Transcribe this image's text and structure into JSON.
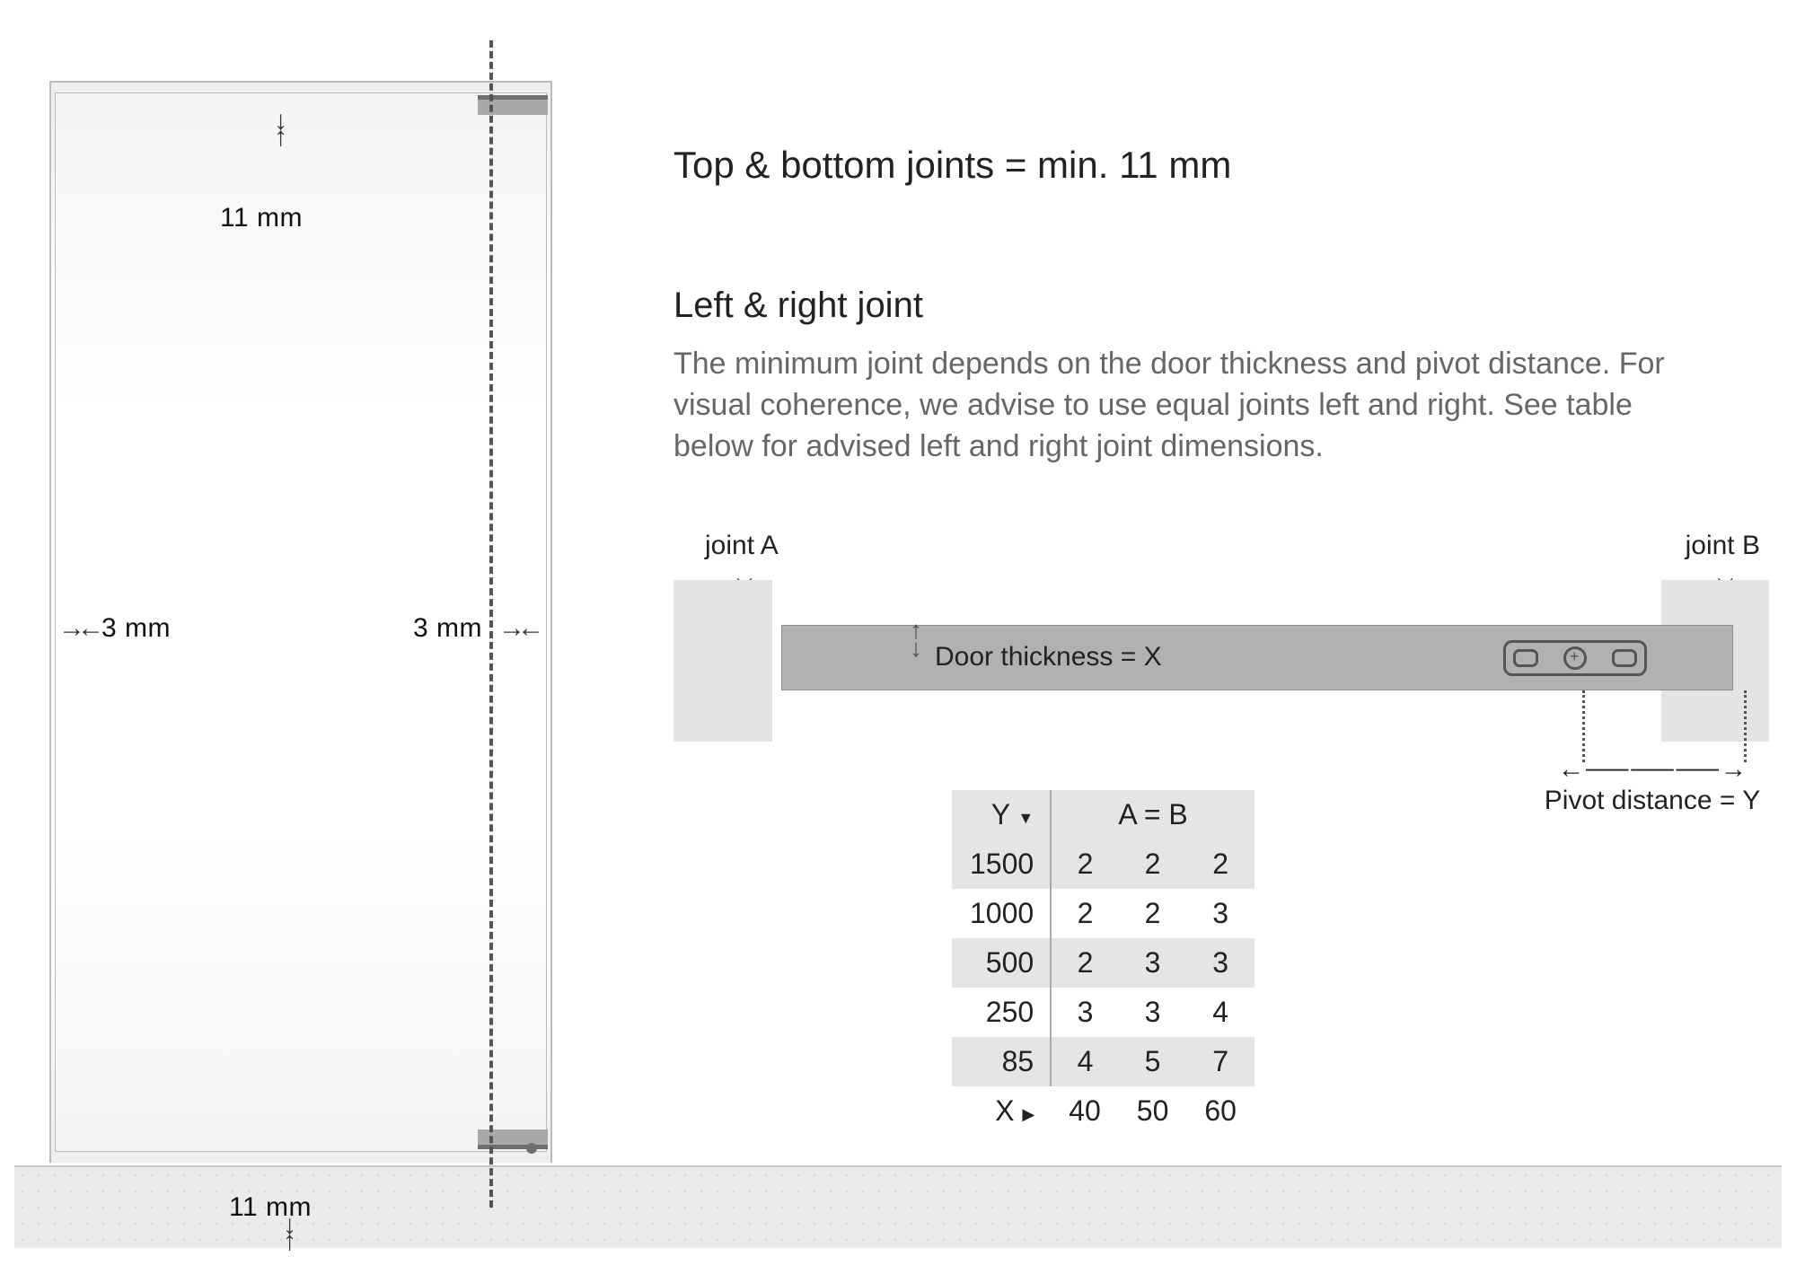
{
  "elevation": {
    "top_joint": "11 mm",
    "bottom_joint": "11 mm",
    "left_joint": "3 mm",
    "right_joint": "3 mm"
  },
  "headline": "Top & bottom joints  = min. 11 mm",
  "section_title": "Left & right joint",
  "section_body": "The minimum joint depends on the door thickness and pivot distance. For visual coherence, we advise to use equal joints left and right. See table below for advised left and right joint dimensions.",
  "topview": {
    "joint_a_label": "joint A",
    "joint_b_label": "joint B",
    "thickness_label": "Door thickness = X",
    "pivot_label": "Pivot distance = Y"
  },
  "table": {
    "y_header": "Y",
    "ab_header": "A = B",
    "x_header": "X",
    "rows": [
      {
        "y": "1500",
        "v": [
          "2",
          "2",
          "2"
        ]
      },
      {
        "y": "1000",
        "v": [
          "2",
          "2",
          "3"
        ]
      },
      {
        "y": "500",
        "v": [
          "2",
          "3",
          "3"
        ]
      },
      {
        "y": "250",
        "v": [
          "3",
          "3",
          "4"
        ]
      },
      {
        "y": "85",
        "v": [
          "4",
          "5",
          "7"
        ]
      }
    ],
    "x_values": [
      "40",
      "50",
      "60"
    ]
  }
}
